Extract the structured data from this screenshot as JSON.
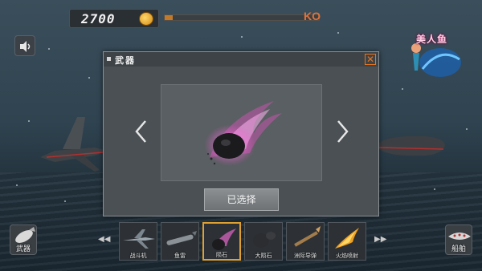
{
  "hud": {
    "score": "2700",
    "ko_label": "KO",
    "progress": 0.05
  },
  "logo": {
    "text": "美人鱼"
  },
  "dialog": {
    "title": "武器",
    "select_label": "已选择",
    "selected_item": "陨石"
  },
  "bottom": {
    "weapon_label": "武器",
    "ship_label": "船舶",
    "slots": [
      {
        "label": "战斗机",
        "icon": "fighter-jet-icon"
      },
      {
        "label": "鱼雷",
        "icon": "torpedo-icon"
      },
      {
        "label": "陨石",
        "icon": "meteor-icon",
        "active": true
      },
      {
        "label": "大陨石",
        "icon": "big-meteor-icon"
      },
      {
        "label": "洲际导弹",
        "icon": "missile-icon"
      },
      {
        "label": "火焰喷射",
        "icon": "flame-icon"
      }
    ]
  },
  "colors": {
    "accent": "#e8741c",
    "active_border": "#e0a030",
    "meteor_glow": "#ff4fd8"
  }
}
